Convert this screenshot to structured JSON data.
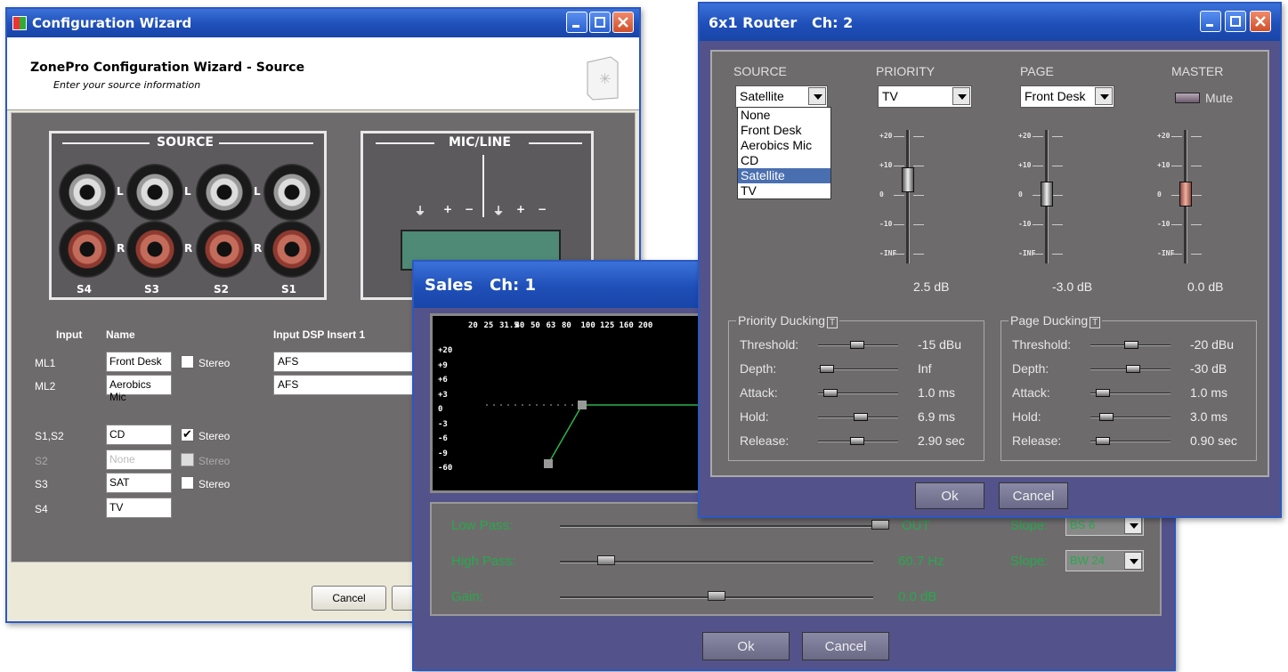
{
  "wizard": {
    "title": "Configuration Wizard",
    "heading": "ZonePro Configuration Wizard - Source",
    "subheading": "Enter your source information",
    "source_panel": "SOURCE",
    "micline_panel": "MIC/LINE",
    "jack_labels": {
      "l": "L",
      "r": "R"
    },
    "slots": [
      "S4",
      "S3",
      "S2",
      "S1"
    ],
    "mic_terminals": [
      "⏚",
      "+",
      "−",
      "⏚",
      "+",
      "−"
    ],
    "col_input": "Input",
    "col_name": "Name",
    "col_dsp": "Input DSP Insert 1",
    "rows": [
      {
        "input": "ML1",
        "name": "Front Desk",
        "stereo_label": "Stereo",
        "stereo": false,
        "dsp": "AFS"
      },
      {
        "input": "ML2",
        "name": "Aerobics Mic",
        "dsp": "AFS"
      },
      {
        "input": "S1,S2",
        "name": "CD",
        "stereo_label": "Stereo",
        "stereo": true
      },
      {
        "input": "S2",
        "name": "None",
        "stereo_label": "Stereo",
        "stereo": false,
        "disabled": true
      },
      {
        "input": "S3",
        "name": "SAT",
        "stereo_label": "Stereo",
        "stereo": false
      },
      {
        "input": "S4",
        "name": "TV"
      }
    ],
    "cancel": "Cancel",
    "check_mark": "✔"
  },
  "sales": {
    "title": "Sales   Ch: 1",
    "freqs": [
      "20",
      "25",
      "31.5",
      "40",
      "50",
      "63",
      "80",
      "100",
      "125",
      "160",
      "200"
    ],
    "db_scale": [
      "+20",
      "+9",
      "+6",
      "+3",
      "0",
      "-3",
      "-6",
      "-9",
      "-60"
    ],
    "low_pass": {
      "label": "Low Pass:",
      "value": "OUT",
      "slope_label": "Slope:",
      "slope": "BS 6"
    },
    "high_pass": {
      "label": "High Pass:",
      "value": "60.7 Hz",
      "slope_label": "Slope:",
      "slope": "BW 24"
    },
    "gain": {
      "label": "Gain:",
      "value": "0.0 dB"
    },
    "ok": "Ok",
    "cancel": "Cancel"
  },
  "router": {
    "title": "6x1 Router   Ch: 2",
    "source_h": "SOURCE",
    "priority_h": "PRIORITY",
    "page_h": "PAGE",
    "master_h": "MASTER",
    "source_sel": "Satellite",
    "priority_sel": "TV",
    "page_sel": "Front Desk",
    "mute": "Mute",
    "options": [
      "None",
      "Front Desk",
      "Aerobics Mic",
      "CD",
      "Satellite",
      "TV"
    ],
    "selected_option": "Satellite",
    "scale": [
      "+20",
      "+10",
      "0",
      "-10",
      "-INF"
    ],
    "priority_val": "2.5 dB",
    "page_val": "-3.0 dB",
    "master_val": "0.0 dB",
    "pd_title": "Priority Ducking",
    "pg_title": "Page Ducking",
    "t_icon": "T",
    "params": [
      "Threshold:",
      "Depth:",
      "Attack:",
      "Hold:",
      "Release:"
    ],
    "pd_vals": [
      "-15 dBu",
      "Inf",
      "1.0 ms",
      "6.9 ms",
      "2.90 sec"
    ],
    "pg_vals": [
      "-20 dBu",
      "-30 dB",
      "1.0 ms",
      "3.0 ms",
      "0.90 sec"
    ],
    "ok": "Ok",
    "cancel": "Cancel"
  }
}
